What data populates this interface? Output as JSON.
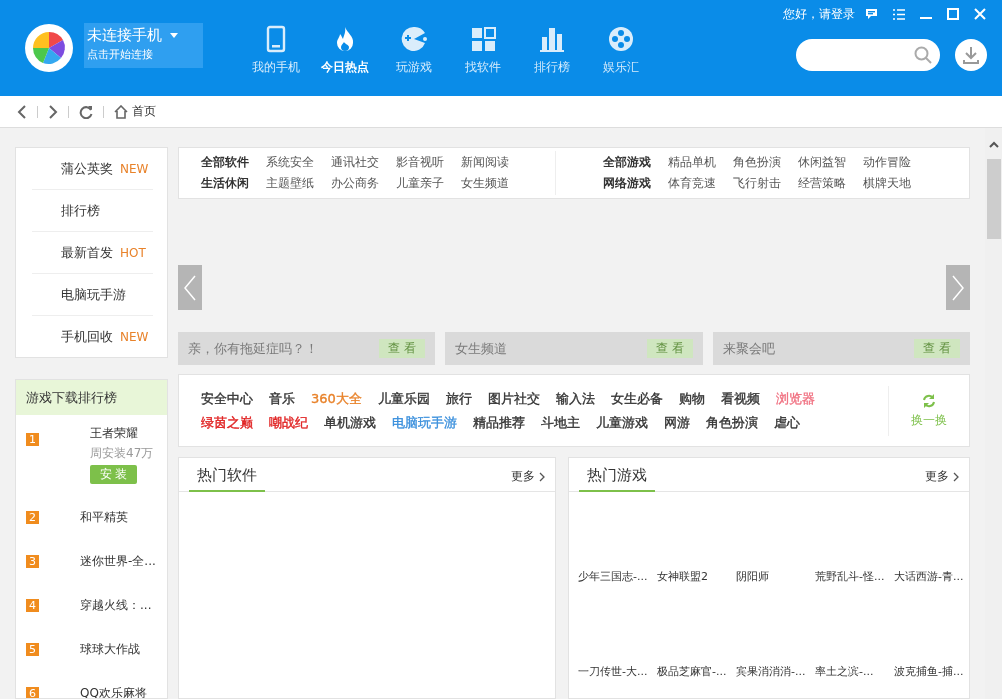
{
  "header": {
    "login": "您好，请登录",
    "device": {
      "title": "未连接手机",
      "subtitle": "点击开始连接"
    },
    "nav": [
      {
        "label": "我的手机",
        "selected": false
      },
      {
        "label": "今日热点",
        "selected": true
      },
      {
        "label": "玩游戏",
        "selected": false
      },
      {
        "label": "找软件",
        "selected": false
      },
      {
        "label": "排行榜",
        "selected": false
      },
      {
        "label": "娱乐汇",
        "selected": false
      }
    ]
  },
  "breadcrumb": "首页",
  "sidebar": {
    "items": [
      {
        "label": "蒲公英奖",
        "badge": "NEW"
      },
      {
        "label": "排行榜"
      },
      {
        "label": "最新首发",
        "badge": "HOT"
      },
      {
        "label": "电脑玩手游"
      },
      {
        "label": "手机回收",
        "badge": "NEW"
      }
    ]
  },
  "ranking": {
    "title": "游戏下载排行榜",
    "items": [
      {
        "rank": "1",
        "name": "王者荣耀",
        "installs": "周安装47万",
        "button": "安 装"
      },
      {
        "rank": "2",
        "name": "和平精英"
      },
      {
        "rank": "3",
        "name": "迷你世界-全..."
      },
      {
        "rank": "4",
        "name": "穿越火线：..."
      },
      {
        "rank": "5",
        "name": "球球大作战"
      },
      {
        "rank": "6",
        "name": "QQ欢乐麻将"
      }
    ]
  },
  "categories": [
    {
      "rows": [
        [
          "全部软件",
          "系统安全",
          "通讯社交",
          "影音视听",
          "新闻阅读"
        ],
        [
          "生活休闲",
          "主题壁纸",
          "办公商务",
          "儿童亲子",
          "女生频道"
        ]
      ]
    },
    {
      "rows": [
        [
          "全部游戏",
          "精品单机",
          "角色扮演",
          "休闲益智",
          "动作冒险"
        ],
        [
          "网络游戏",
          "体育竞速",
          "飞行射击",
          "经营策略",
          "棋牌天地"
        ]
      ]
    }
  ],
  "promos": [
    {
      "text": "亲，你有拖延症吗？！",
      "button": "查 看"
    },
    {
      "text": "女生频道",
      "button": "查 看"
    },
    {
      "text": "来聚会吧",
      "button": "查 看"
    }
  ],
  "tags": {
    "items": [
      {
        "label": "安全中心",
        "color": "#333333"
      },
      {
        "label": "音乐",
        "color": "#333333"
      },
      {
        "label": "360大全",
        "color": "#e8822a"
      },
      {
        "label": "儿童乐园",
        "color": "#333333"
      },
      {
        "label": "旅行",
        "color": "#333333"
      },
      {
        "label": "图片社交",
        "color": "#333333"
      },
      {
        "label": "输入法",
        "color": "#333333"
      },
      {
        "label": "女生必备",
        "color": "#333333"
      },
      {
        "label": "购物",
        "color": "#333333"
      },
      {
        "label": "看视频",
        "color": "#333333"
      },
      {
        "label": "浏览器",
        "color": "#f07080"
      },
      {
        "label": "绿茵之巅",
        "color": "#e02020"
      },
      {
        "label": "嘲战纪",
        "color": "#e02020"
      },
      {
        "label": "单机游戏",
        "color": "#333333"
      },
      {
        "label": "电脑玩手游",
        "color": "#3a8fdc"
      },
      {
        "label": "精品推荐",
        "color": "#333333"
      },
      {
        "label": "斗地主",
        "color": "#333333"
      },
      {
        "label": "儿童游戏",
        "color": "#333333"
      },
      {
        "label": "网游",
        "color": "#333333"
      },
      {
        "label": "角色扮演",
        "color": "#333333"
      },
      {
        "label": "虐心",
        "color": "#333333"
      }
    ],
    "refresh": "换一换"
  },
  "sections": [
    {
      "title": "热门软件",
      "more": "更多"
    },
    {
      "title": "热门游戏",
      "more": "更多",
      "items": [
        [
          "少年三国志-...",
          "女神联盟2",
          "阴阳师",
          "荒野乱斗-怪...",
          "大话西游-青..."
        ],
        [
          "一刀传世-大...",
          "极品芝麻官-...",
          "宾果消消消-...",
          "率土之滨-...",
          "波克捕鱼-捕..."
        ]
      ]
    }
  ]
}
